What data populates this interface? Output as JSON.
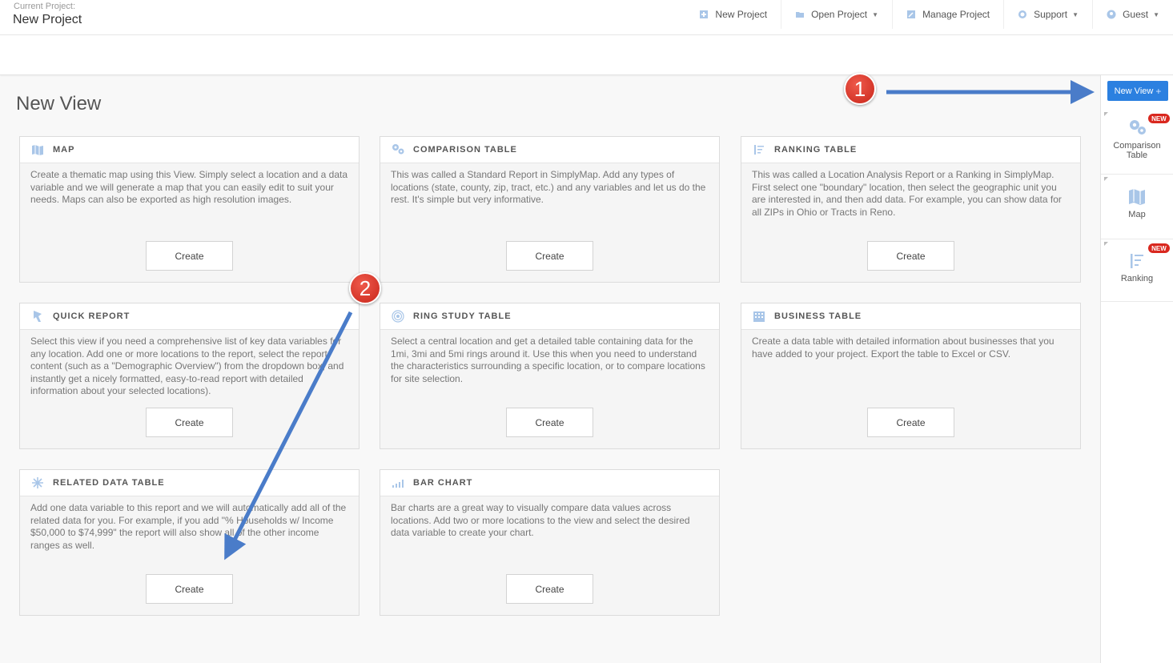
{
  "header": {
    "project_label": "Current Project:",
    "project_name": "New Project",
    "nav": [
      {
        "label": "New Project",
        "icon": "new-project-icon"
      },
      {
        "label": "Open Project",
        "icon": "folder-icon"
      },
      {
        "label": "Manage Project",
        "icon": "manage-icon"
      },
      {
        "label": "Support",
        "icon": "support-icon"
      },
      {
        "label": "Guest",
        "icon": "user-icon"
      }
    ]
  },
  "main": {
    "title": "New View",
    "create_label": "Create",
    "cards": [
      {
        "title": "MAP",
        "icon": "map-icon",
        "desc": "Create a thematic map using this View. Simply select a location and a data variable and we will generate a map that you can easily edit to suit your needs. Maps can also be exported as high resolution images."
      },
      {
        "title": "COMPARISON TABLE",
        "icon": "comparison-icon",
        "desc": "This was called a Standard Report in SimplyMap. Add any types of locations (state, county, zip, tract, etc.) and any variables and let us do the rest. It's simple but very informative."
      },
      {
        "title": "RANKING TABLE",
        "icon": "ranking-icon",
        "desc": "This was called a Location Analysis Report or a Ranking in SimplyMap. First select one \"boundary\" location, then select the geographic unit you are interested in, and then add data. For example, you can show data for all ZIPs in Ohio or Tracts in Reno."
      },
      {
        "title": "QUICK REPORT",
        "icon": "quick-report-icon",
        "desc": "Select this view if you need a comprehensive list of key data variables for any location. Add one or more locations to the report, select the report content (such as a \"Demographic Overview\") from the dropdown box, and instantly get a nicely formatted, easy-to-read report with detailed information about your selected locations)."
      },
      {
        "title": "RING STUDY TABLE",
        "icon": "ring-icon",
        "desc": "Select a central location and get a detailed table containing data for the 1mi, 3mi and 5mi rings around it. Use this when you need to understand the characteristics surrounding a specific location, or to compare locations for site selection."
      },
      {
        "title": "BUSINESS TABLE",
        "icon": "business-icon",
        "desc": "Create a data table with detailed information about businesses that you have added to your project. Export the table to Excel or CSV."
      },
      {
        "title": "RELATED DATA TABLE",
        "icon": "related-data-icon",
        "desc": "Add one data variable to this report and we will automatically add all of the related data for you. For example, if you add \"% Households w/ Income $50,000 to $74,999\" the report will also show all of the other income ranges as well."
      },
      {
        "title": "BAR CHART",
        "icon": "bar-chart-icon",
        "desc": "Bar charts are a great way to visually compare data values across locations. Add two or more locations to the view and select the desired data variable to create your chart."
      }
    ]
  },
  "sidebar": {
    "new_view_label": "New View",
    "new_view_plus": "+",
    "badge": "NEW",
    "items": [
      {
        "label_line1": "Comparison",
        "label_line2": "Table",
        "icon": "comparison-icon",
        "new": true
      },
      {
        "label_line1": "Map",
        "label_line2": "",
        "icon": "map-icon",
        "new": false
      },
      {
        "label_line1": "Ranking",
        "label_line2": "",
        "icon": "ranking-icon",
        "new": true
      }
    ]
  },
  "annotations": {
    "marker1": "1",
    "marker2": "2"
  },
  "colors": {
    "accent": "#2b80e0",
    "badge": "#d9281f",
    "icon": "#a9c6e8",
    "marker": "#d7372a",
    "arrow": "#4a7cc9"
  }
}
